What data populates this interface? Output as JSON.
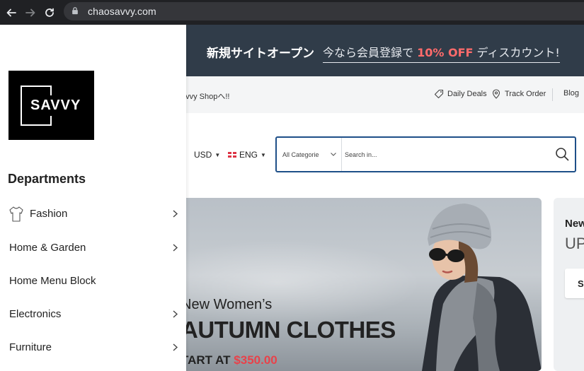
{
  "browser": {
    "url": "chaosavvy.com"
  },
  "promo": {
    "title": "新規サイトオープン",
    "offer_prefix": "今なら会員登録で",
    "offer_highlight": "10% OFF",
    "offer_suffix": "ディスカウント!"
  },
  "util_bar": {
    "welcome": "avvy Shopへ!!",
    "daily_deals": "Daily Deals",
    "track_order": "Track Order",
    "blog": "Blog"
  },
  "header": {
    "currency": "USD",
    "language": "ENG",
    "category_select": "All Categorie",
    "search_placeholder": "Search in..."
  },
  "hero": {
    "subtitle": "New Women’s",
    "title": "AUTUMN CLOTHES",
    "price_prefix": "TART AT",
    "price_value": "$350.00"
  },
  "side_banner": {
    "new_label": "New",
    "up_label": "UP",
    "button_label": "S"
  },
  "drawer": {
    "logo_text": "SAVVY",
    "departments_title": "Departments",
    "items": [
      {
        "label": "Fashion",
        "icon": "shirt-icon",
        "has_submenu": true
      },
      {
        "label": "Home & Garden",
        "has_submenu": true
      },
      {
        "label": "Home Menu Block",
        "has_submenu": false
      },
      {
        "label": "Electronics",
        "has_submenu": true
      },
      {
        "label": "Furniture",
        "has_submenu": true
      }
    ]
  },
  "colors": {
    "chrome_bg": "#202124",
    "promo_bg": "#303c49",
    "promo_highlight": "#ff6b6b",
    "search_border": "#1e4f88",
    "price_accent": "#e8424a"
  }
}
